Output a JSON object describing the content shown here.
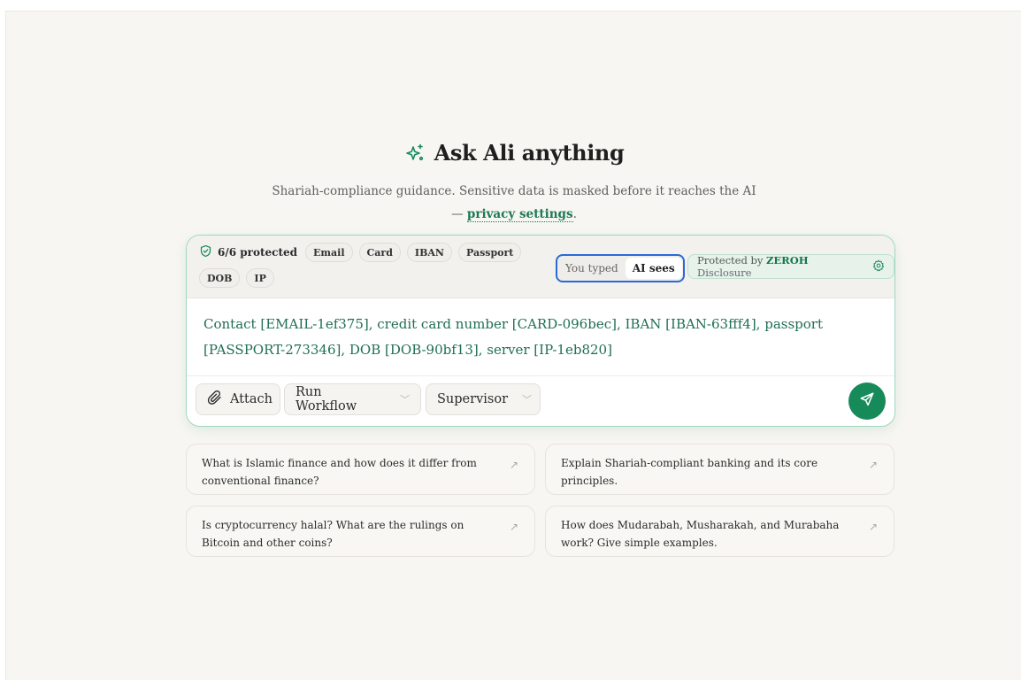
{
  "hero": {
    "title": "Ask Ali anything",
    "subtitle_text": "Shariah-compliance guidance. Sensitive data is masked before it reaches the AI — ",
    "subtitle_link": "privacy settings",
    "subtitle_end": "."
  },
  "privacy_bar": {
    "protected_label": "6/6 protected",
    "chips": [
      "Email",
      "Card",
      "IBAN",
      "Passport",
      "DOB",
      "IP"
    ],
    "toggle": {
      "you_typed": "You typed",
      "ai_sees": "AI sees",
      "selected": "AI sees"
    },
    "badge": {
      "prefix": "Protected by",
      "brand": "ZEROH",
      "suffix": "Disclosure"
    }
  },
  "composer": {
    "text": "Contact [EMAIL-1ef375], credit card number [CARD-096bec], IBAN [IBAN-63fff4], passport [PASSPORT-273346], DOB [DOB-90bf13], server [IP-1eb820]"
  },
  "toolbar": {
    "attach_label": "Attach",
    "workflow_label": "Run Workflow",
    "mode_label": "Supervisor"
  },
  "suggestions": [
    {
      "text": "What is Islamic finance and how does it differ from conventional finance?"
    },
    {
      "text": "Explain Shariah-compliant banking and its core principles."
    },
    {
      "text": "Is cryptocurrency halal? What are the rulings on Bitcoin and other coins?"
    },
    {
      "text": "How does Mudarabah, Musharakah, and Murabaha work? Give simple examples."
    }
  ],
  "colors": {
    "accent": "#178a5a",
    "masked_text": "#1f6f51",
    "toggle_focus": "#2a6ad8"
  },
  "icons": {
    "title": "sparkles-icon",
    "shield": "shield-check-icon",
    "settings": "gear-icon",
    "attach": "paperclip-icon",
    "send": "send-icon",
    "suggestion": "arrow-up-right-icon"
  }
}
